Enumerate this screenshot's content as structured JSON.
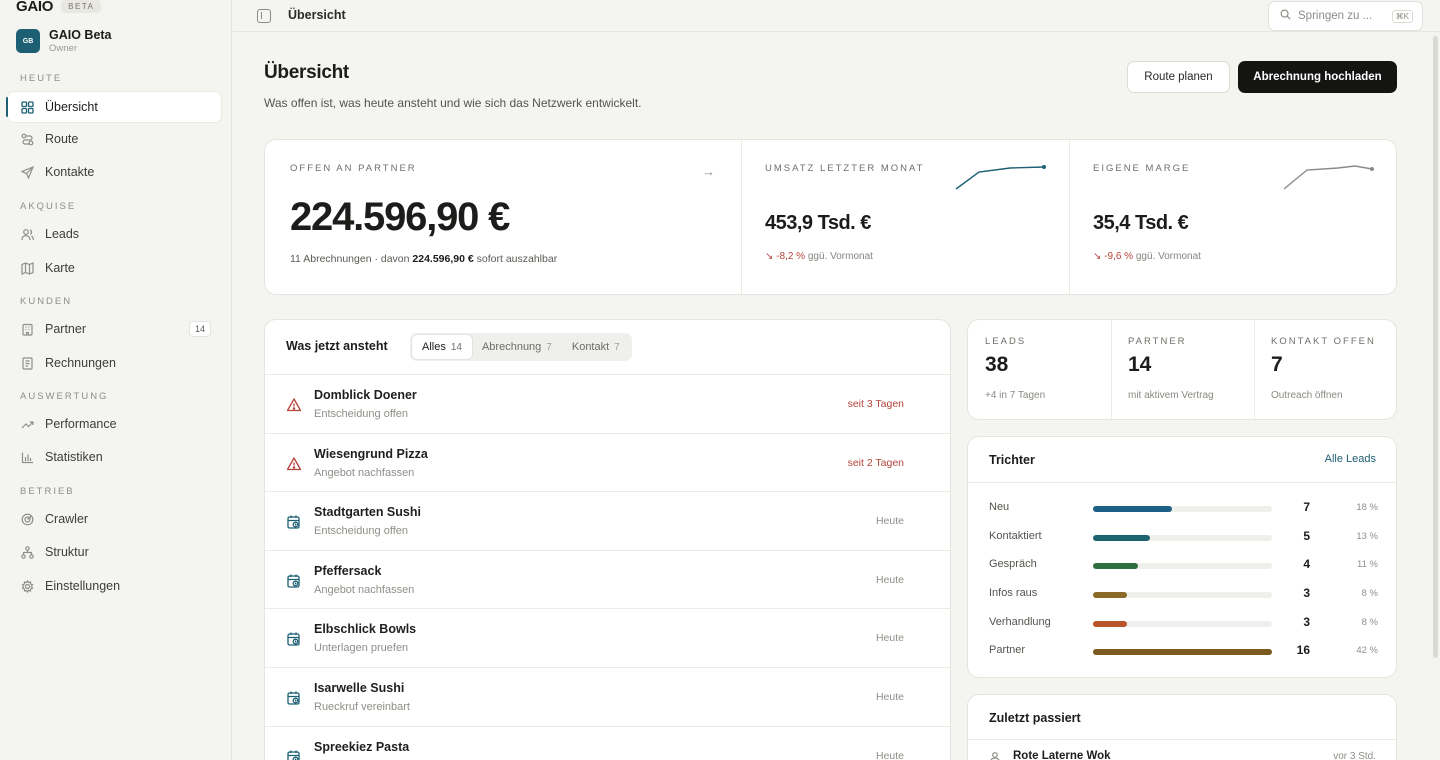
{
  "brand": {
    "name": "GAIO",
    "badge": "BETA"
  },
  "org": {
    "initials": "GB",
    "name": "GAIO Beta",
    "role": "Owner"
  },
  "nav": {
    "sections": [
      "HEUTE",
      "AKQUISE",
      "KUNDEN",
      "AUSWERTUNG",
      "BETRIEB"
    ],
    "items": [
      {
        "label": "Übersicht",
        "icon": "grid-icon",
        "active": true
      },
      {
        "label": "Route",
        "icon": "route-icon"
      },
      {
        "label": "Kontakte",
        "icon": "send-icon"
      },
      {
        "label": "Leads",
        "icon": "users-icon"
      },
      {
        "label": "Karte",
        "icon": "map-icon"
      },
      {
        "label": "Partner",
        "icon": "building-icon",
        "count": "14"
      },
      {
        "label": "Rechnungen",
        "icon": "receipt-icon"
      },
      {
        "label": "Performance",
        "icon": "trend-icon"
      },
      {
        "label": "Statistiken",
        "icon": "bar-chart-icon"
      },
      {
        "label": "Crawler",
        "icon": "radar-icon"
      },
      {
        "label": "Struktur",
        "icon": "hierarchy-icon"
      },
      {
        "label": "Einstellungen",
        "icon": "gear-icon"
      }
    ]
  },
  "topbar": {
    "breadcrumb": "Übersicht",
    "search_placeholder": "Springen zu ...",
    "search_kbd": "⌘K"
  },
  "page": {
    "title": "Übersicht",
    "subtitle": "Was offen ist, was heute ansteht und wie sich das Netzwerk entwickelt.",
    "btn_route": "Route planen",
    "btn_upload": "Abrechnung hochladen"
  },
  "kpi": {
    "open": {
      "label": "OFFEN AN PARTNER",
      "value": "224.596,90 €",
      "meta_prefix": "11 Abrechnungen · davon",
      "meta_bold": "224.596,90 €",
      "meta_suffix": "sofort auszahlbar"
    },
    "revenue": {
      "label": "UMSATZ LETZTER MONAT",
      "value": "453,9 Tsd. €",
      "delta": "-8,2 %",
      "delta_suffix": "ggü. Vormonat"
    },
    "margin": {
      "label": "EIGENE MARGE",
      "value": "35,4 Tsd. €",
      "delta": "-9,6 %",
      "delta_suffix": "ggü. Vormonat"
    }
  },
  "tasks": {
    "title": "Was jetzt ansteht",
    "tabs": [
      {
        "label": "Alles",
        "count": "14"
      },
      {
        "label": "Abrechnung",
        "count": "7"
      },
      {
        "label": "Kontakt",
        "count": "7"
      }
    ],
    "rows": [
      {
        "name": "Domblick Doener",
        "sub": "Entscheidung offen",
        "when": "seit 3 Tagen",
        "type": "warning"
      },
      {
        "name": "Wiesengrund Pizza",
        "sub": "Angebot nachfassen",
        "when": "seit 2 Tagen",
        "type": "warning"
      },
      {
        "name": "Stadtgarten Sushi",
        "sub": "Entscheidung offen",
        "when": "Heute",
        "type": "calendar"
      },
      {
        "name": "Pfeffersack",
        "sub": "Angebot nachfassen",
        "when": "Heute",
        "type": "calendar"
      },
      {
        "name": "Elbschlick Bowls",
        "sub": "Unterlagen pruefen",
        "when": "Heute",
        "type": "calendar"
      },
      {
        "name": "Isarwelle Sushi",
        "sub": "Rueckruf vereinbart",
        "when": "Heute",
        "type": "calendar"
      },
      {
        "name": "Spreekiez Pasta",
        "sub": "",
        "when": "Heute",
        "type": "calendar"
      }
    ]
  },
  "stats": [
    {
      "label": "LEADS",
      "value": "38",
      "sub": "+4 in 7 Tagen"
    },
    {
      "label": "PARTNER",
      "value": "14",
      "sub": "mit aktivem Vertrag"
    },
    {
      "label": "KONTAKT OFFEN",
      "value": "7",
      "sub": "Outreach öffnen"
    }
  ],
  "funnel": {
    "title": "Trichter",
    "link": "Alle Leads",
    "rows": [
      {
        "label": "Neu",
        "count": "7",
        "pct": "18 %",
        "share": 0.44,
        "color": "#1d5f86"
      },
      {
        "label": "Kontaktiert",
        "count": "5",
        "pct": "13 %",
        "share": 0.32,
        "color": "#1d6470"
      },
      {
        "label": "Gespräch",
        "count": "4",
        "pct": "11 %",
        "share": 0.25,
        "color": "#2e6f3e"
      },
      {
        "label": "Infos raus",
        "count": "3",
        "pct": "8 %",
        "share": 0.19,
        "color": "#8a6a26"
      },
      {
        "label": "Verhandlung",
        "count": "3",
        "pct": "8 %",
        "share": 0.19,
        "color": "#b8552a"
      },
      {
        "label": "Partner",
        "count": "16",
        "pct": "42 %",
        "share": 1.0,
        "color": "#7a5a1e"
      }
    ]
  },
  "recent": {
    "title": "Zuletzt passiert",
    "rows": [
      {
        "name": "Rote Laterne Wok",
        "time": "vor 3 Std."
      }
    ]
  }
}
